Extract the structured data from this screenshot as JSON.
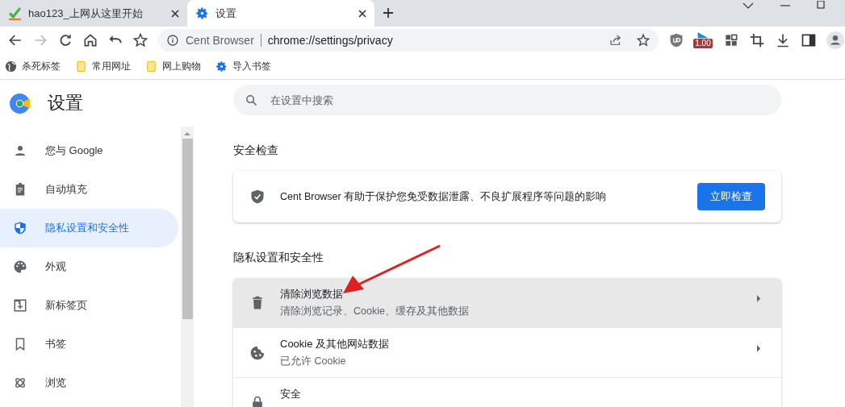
{
  "tabs": [
    {
      "title": "hao123_上网从这里开始",
      "kind": "hao",
      "selected": false
    },
    {
      "title": "设置",
      "kind": "gear",
      "selected": true
    }
  ],
  "address_bar": {
    "site": "Cent Browser",
    "url": "chrome://settings/privacy"
  },
  "extension_badge": "1.00",
  "bookmarks": [
    {
      "label": "杀死标签",
      "kind": "globe"
    },
    {
      "label": "常用网址",
      "kind": "folder"
    },
    {
      "label": "网上购物",
      "kind": "folder"
    },
    {
      "label": "导入书签",
      "kind": "gear"
    }
  ],
  "sidebar": {
    "title": "设置",
    "items": [
      {
        "label": "您与 Google",
        "kind": "person",
        "selected": false
      },
      {
        "label": "自动填充",
        "kind": "clipboard",
        "selected": false
      },
      {
        "label": "隐私设置和安全性",
        "kind": "shield",
        "selected": true
      },
      {
        "label": "外观",
        "kind": "palette",
        "selected": false
      },
      {
        "label": "新标签页",
        "kind": "newtab",
        "selected": false
      },
      {
        "label": "书签",
        "kind": "bookmark",
        "selected": false
      },
      {
        "label": "浏览",
        "kind": "atom",
        "selected": false
      }
    ]
  },
  "search": {
    "placeholder": "在设置中搜索"
  },
  "safety_check": {
    "heading": "安全检查",
    "text": "Cent Browser 有助于保护您免受数据泄露、不良扩展程序等问题的影响",
    "button": "立即检查"
  },
  "privacy": {
    "heading": "隐私设置和安全性",
    "rows": [
      {
        "title": "清除浏览数据",
        "subtitle": "清除浏览记录、Cookie、缓存及其他数据",
        "kind": "trash",
        "hovered": true
      },
      {
        "title": "Cookie 及其他网站数据",
        "subtitle": "已允许 Cookie",
        "kind": "cookie",
        "hovered": false
      },
      {
        "title": "安全",
        "kind": "lock",
        "hovered": false
      }
    ]
  }
}
